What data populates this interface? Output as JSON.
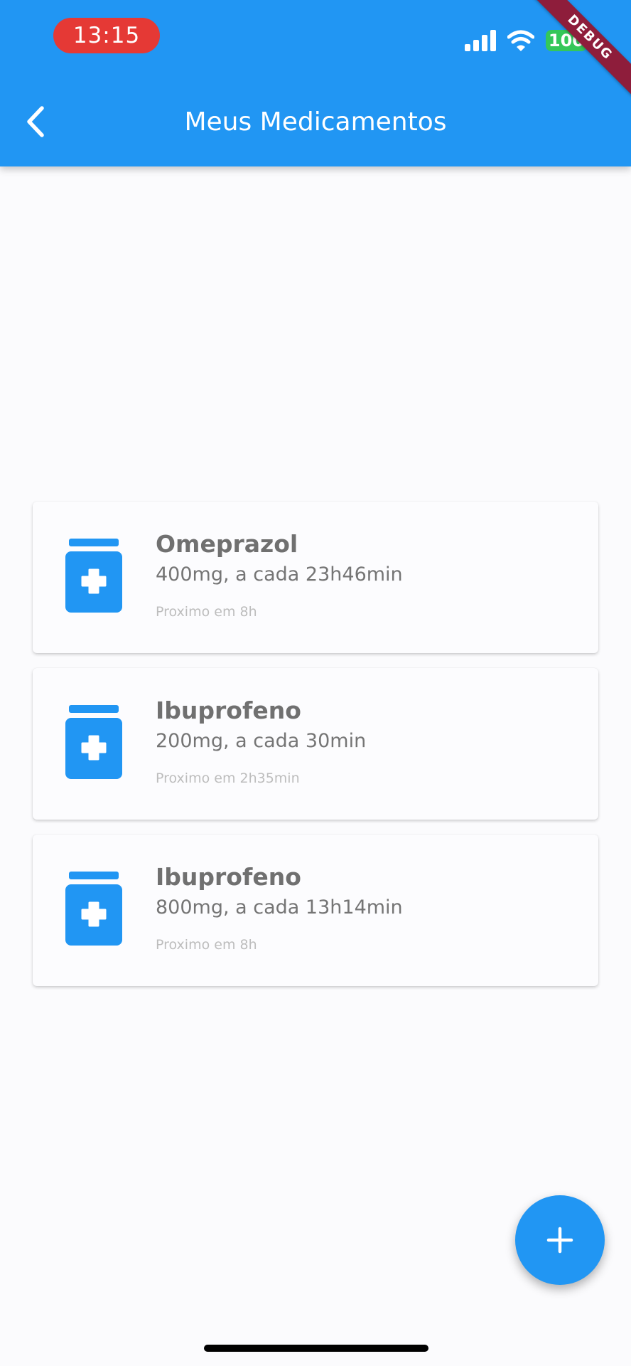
{
  "status_bar": {
    "time": "13:15",
    "battery": "100",
    "icons": [
      "signal-icon",
      "wifi-icon",
      "battery-icon"
    ]
  },
  "debug_banner": "DEBUG",
  "app_bar": {
    "title": "Meus Medicamentos",
    "back_icon": "chevron-left-icon"
  },
  "medications": [
    {
      "name": "Omeprazol",
      "dose": "400mg, a cada 23h46min",
      "next": "Proximo em 8h",
      "icon": "medicine-jar-icon"
    },
    {
      "name": "Ibuprofeno",
      "dose": "200mg, a cada 30min",
      "next": "Proximo em 2h35min",
      "icon": "medicine-jar-icon"
    },
    {
      "name": "Ibuprofeno",
      "dose": "800mg, a cada 13h14min",
      "next": "Proximo em 8h",
      "icon": "medicine-jar-icon"
    }
  ],
  "fab": {
    "icon": "plus-icon"
  },
  "colors": {
    "primary": "#2196f3",
    "status_time_bg": "#e53935",
    "battery": "#34c759",
    "debug_ribbon": "#8e1d3b",
    "background": "#fbfbfd",
    "title_text": "#707070",
    "subtitle_text": "#757575",
    "hint_text": "#bdbdbd"
  }
}
